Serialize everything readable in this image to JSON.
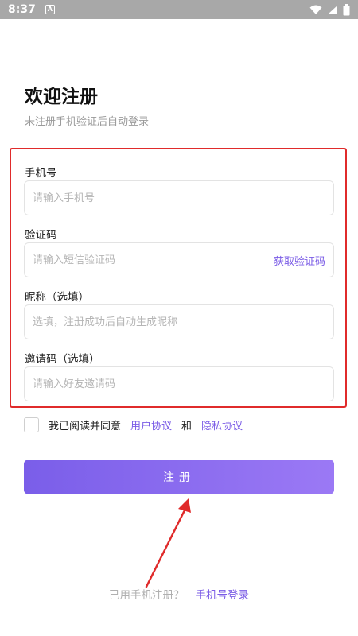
{
  "status_bar": {
    "time": "8:37",
    "notification_glyph": "A",
    "icons": [
      "wifi-icon",
      "signal-icon",
      "battery-icon"
    ]
  },
  "header": {
    "title": "欢迎注册",
    "subtitle": "未注册手机验证后自动登录"
  },
  "form": {
    "phone": {
      "label": "手机号",
      "placeholder": "请输入手机号",
      "value": ""
    },
    "code": {
      "label": "验证码",
      "placeholder": "请输入短信验证码",
      "value": "",
      "action_label": "获取验证码"
    },
    "nickname": {
      "label": "昵称（选填）",
      "placeholder": "选填，注册成功后自动生成昵称",
      "value": ""
    },
    "invite": {
      "label": "邀请码（选填）",
      "placeholder": "请输入好友邀请码",
      "value": ""
    }
  },
  "agreement": {
    "prefix": "我已阅读并同意",
    "user_agreement": "用户协议",
    "conjunction": "和",
    "privacy_policy": "隐私协议",
    "checked": false
  },
  "register_button": {
    "label": "注册"
  },
  "footer": {
    "prompt": "已用手机注册？",
    "login_link": "手机号登录"
  },
  "colors": {
    "accent": "#7b5ce6",
    "annotation": "#e02b2b",
    "button_start": "#7a5ee9",
    "button_end": "#9b79f5"
  }
}
